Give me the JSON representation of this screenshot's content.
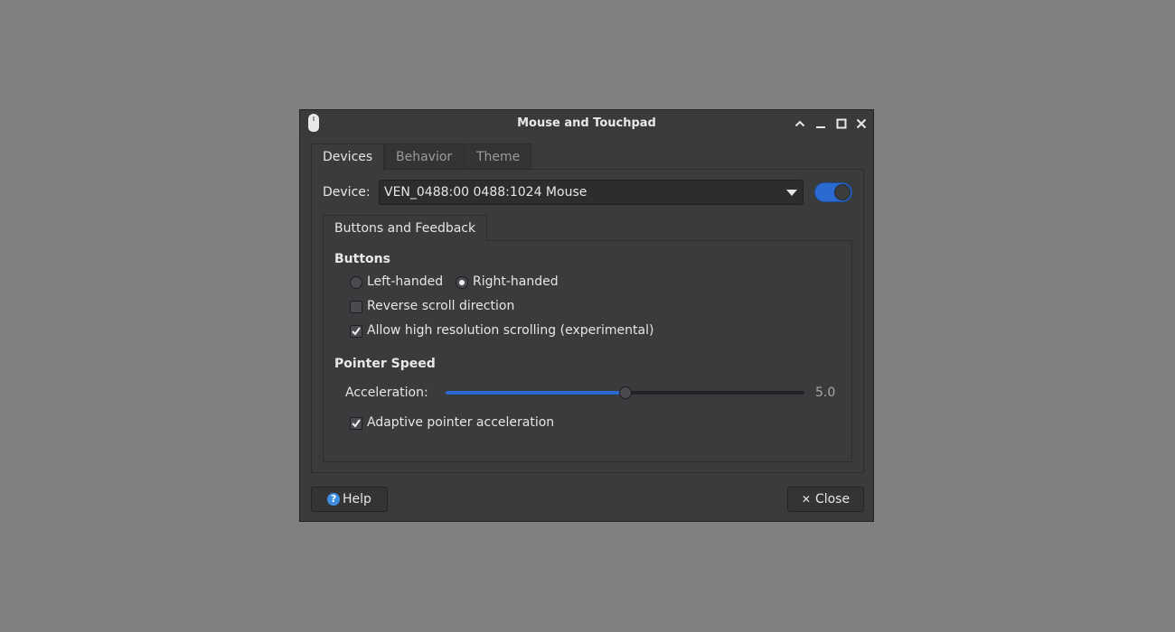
{
  "window": {
    "title": "Mouse and Touchpad"
  },
  "tabs": [
    {
      "label": "Devices",
      "active": true
    },
    {
      "label": "Behavior",
      "active": false
    },
    {
      "label": "Theme",
      "active": false
    }
  ],
  "device": {
    "label": "Device:",
    "selected": "VEN_0488:00 0488:1024 Mouse",
    "enabled": true
  },
  "inner_tab": {
    "label": "Buttons and Feedback"
  },
  "buttons_section": {
    "title": "Buttons",
    "left_handed": "Left-handed",
    "right_handed": "Right-handed",
    "handedness_selected": "Right-handed",
    "reverse_scroll": "Reverse scroll direction",
    "reverse_scroll_checked": false,
    "high_res": "Allow high resolution scrolling (experimental)",
    "high_res_checked": true
  },
  "pointer_section": {
    "title": "Pointer Speed",
    "acceleration_label": "Acceleration:",
    "acceleration_value": "5.0",
    "acceleration_fraction": 0.5,
    "adaptive": "Adaptive pointer acceleration",
    "adaptive_checked": true
  },
  "footer": {
    "help_label": "Help",
    "close_label": "Close"
  },
  "colors": {
    "accent": "#2b6ad1",
    "background": "#808080",
    "window": "#3a3b3d"
  }
}
